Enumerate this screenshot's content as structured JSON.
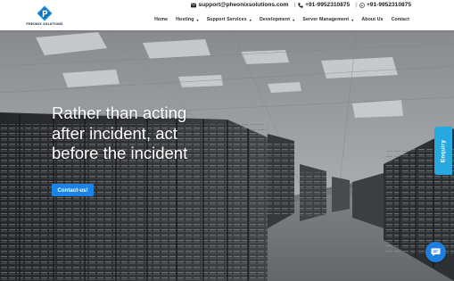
{
  "brand": {
    "name": "PHEONIX SOLUTIONS",
    "logo_icon": "p-logo-icon",
    "accent": "#1b83e8"
  },
  "contact": {
    "email": "support@pheonixsolutions.com",
    "phone": "+91-9952310875",
    "whatsapp": "+91-9952310875",
    "separator": "|"
  },
  "nav": {
    "items": [
      {
        "label": "Home",
        "has_dropdown": false
      },
      {
        "label": "Hosting",
        "has_dropdown": true
      },
      {
        "label": "Support Services",
        "has_dropdown": true
      },
      {
        "label": "Development",
        "has_dropdown": true
      },
      {
        "label": "Server Management",
        "has_dropdown": true
      },
      {
        "label": "About Us",
        "has_dropdown": false
      },
      {
        "label": "Contact",
        "has_dropdown": false
      }
    ],
    "dropdown_glyph": "▾"
  },
  "hero": {
    "title_lines": [
      "Rather than acting",
      "after incident, act",
      "before the incident"
    ],
    "cta_label": "Contact-us!"
  },
  "widgets": {
    "enquiry_label": "Enquiry",
    "enquiry_color": "#27a8df",
    "chat_icon": "chat-bubble-icon"
  }
}
